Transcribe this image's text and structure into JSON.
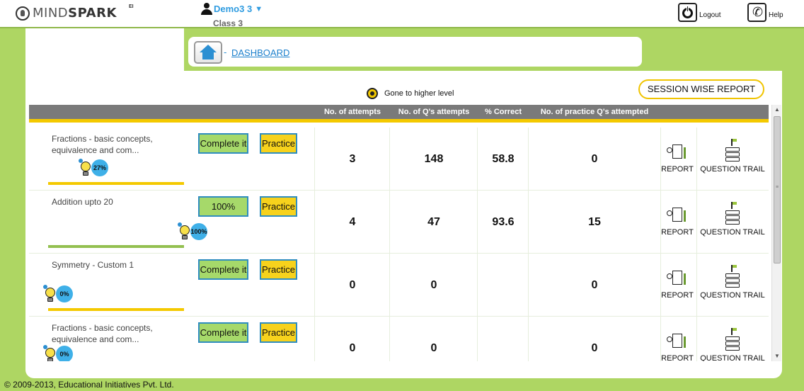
{
  "header": {
    "logo_text_light": "MIND",
    "logo_text_bold": "SPARK",
    "logo_superscript": "EI",
    "user_name": "Demo3 3",
    "user_caret": "▼",
    "user_class": "Class 3",
    "logout_label": "Logout",
    "help_label": "Help",
    "help_glyph": "✆"
  },
  "breadcrumb": {
    "separator": "-",
    "label": "DASHBOARD"
  },
  "legend": {
    "label": "Gone to higher level"
  },
  "session_button": {
    "label": "SESSION WISE REPORT"
  },
  "table": {
    "columns": [
      "No. of attempts",
      "No. of Q's attempts",
      "% Correct",
      "No. of practice Q's attempted"
    ],
    "report_label": "REPORT",
    "trail_label": "QUESTION TRAIL",
    "rows": [
      {
        "topic": "Fractions - basic concepts, equivalence and com...",
        "status_button": "Complete it",
        "status_done": false,
        "practice": "Practice",
        "progress_percent": "27%",
        "progress_value": 0.27,
        "attempts": "3",
        "questions": "148",
        "correct": "58.8",
        "practice_attempted": "0",
        "bar_color": "#f4c900"
      },
      {
        "topic": "Addition upto 20",
        "status_button": "100%",
        "status_done": true,
        "practice": "Practice",
        "progress_percent": "100%",
        "progress_value": 1.0,
        "attempts": "4",
        "questions": "47",
        "correct": "93.6",
        "practice_attempted": "15",
        "bar_color": "#93c050"
      },
      {
        "topic": "Symmetry - Custom 1",
        "status_button": "Complete it",
        "status_done": false,
        "practice": "Practice",
        "progress_percent": "0%",
        "progress_value": 0.0,
        "attempts": "0",
        "questions": "0",
        "correct": "",
        "practice_attempted": "0",
        "bar_color": "#f4c900"
      },
      {
        "topic": "Fractions - basic concepts, equivalence and com...",
        "status_button": "Complete it",
        "status_done": false,
        "practice": "Practice",
        "progress_percent": "0%",
        "progress_value": 0.0,
        "attempts": "0",
        "questions": "0",
        "correct": "",
        "practice_attempted": "0",
        "bar_color": "#f4c900"
      }
    ]
  },
  "footer": {
    "copyright": "© 2009-2013, Educational Initiatives Pvt. Ltd."
  },
  "colors": {
    "background": "#aed663",
    "header_row": "#7a7a7a",
    "accent_yellow": "#f4c900",
    "complete_green": "#a6d96a",
    "practice_yellow": "#f7d21c",
    "link_blue": "#1a7fcc"
  },
  "icons": [
    "mindspark-bulb-icon",
    "user-icon",
    "power-icon",
    "phone-icon",
    "home-icon",
    "higher-level-icon",
    "bulb-icon",
    "report-icon",
    "question-trail-icon"
  ]
}
